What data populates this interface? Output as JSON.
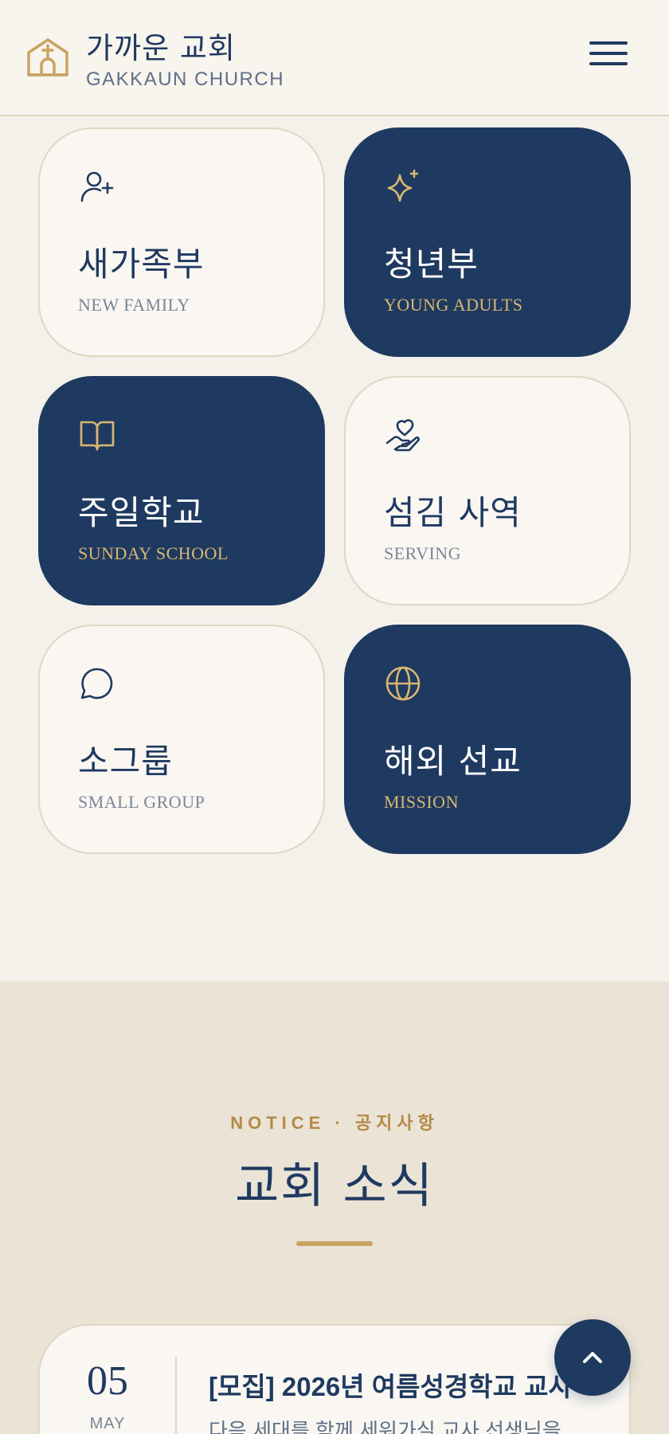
{
  "header": {
    "brand_ko": "가까운 교회",
    "brand_en": "GAKKAUN CHURCH",
    "logo_icon": "church-icon",
    "menu_icon": "hamburger-menu-icon"
  },
  "ministries": [
    {
      "title": "새가족부",
      "subtitle": "NEW FAMILY",
      "icon": "user-plus-icon",
      "theme": "light"
    },
    {
      "title": "청년부",
      "subtitle": "YOUNG ADULTS",
      "icon": "sparkle-icon",
      "theme": "dark"
    },
    {
      "title": "주일학교",
      "subtitle": "SUNDAY SCHOOL",
      "icon": "open-book-icon",
      "theme": "dark"
    },
    {
      "title": "섬김 사역",
      "subtitle": "SERVING",
      "icon": "heart-hand-icon",
      "theme": "light"
    },
    {
      "title": "소그룹",
      "subtitle": "SMALL GROUP",
      "icon": "chat-bubble-icon",
      "theme": "light"
    },
    {
      "title": "해외 선교",
      "subtitle": "MISSION",
      "icon": "globe-icon",
      "theme": "dark"
    }
  ],
  "notice": {
    "eyebrow": "NOTICE · 공지사항",
    "title": "교회 소식",
    "items": [
      {
        "day": "05",
        "month": "MAY",
        "title": "[모집] 2026년 여름성경학교 교사",
        "excerpt": "다음 세대를 함께 세워가실 교사 선생님을 ..."
      }
    ]
  },
  "fab": {
    "icon": "chevron-up-icon"
  },
  "colors": {
    "navy": "#1f3a60",
    "gold": "#c9a461",
    "background": "#f4f0ea",
    "section_background": "#ebe3d6"
  }
}
